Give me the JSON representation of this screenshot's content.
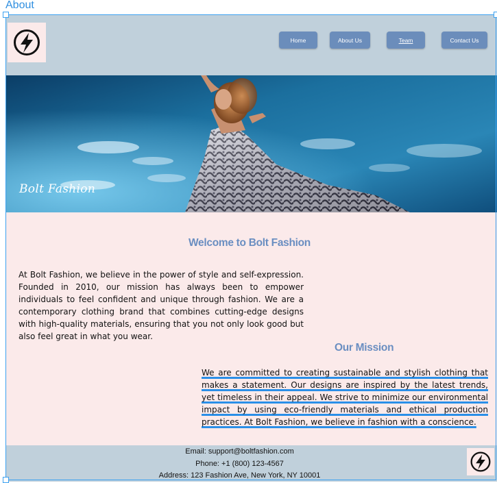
{
  "frame": {
    "label": "About"
  },
  "header": {
    "logo_icon": "lightning-bolt-icon",
    "nav": [
      {
        "label": "Home",
        "current": false
      },
      {
        "label": "About Us",
        "current": false
      },
      {
        "label": "Team",
        "current": true
      },
      {
        "label": "Contact Us",
        "current": false
      }
    ]
  },
  "hero": {
    "brand": "Bolt Fashion"
  },
  "welcome": {
    "title": "Welcome to Bolt Fashion",
    "body": "At Bolt Fashion, we believe in the power of style and self-expression. Founded in 2010, our mission has always been to empower individuals to feel confident and unique through fashion. We are a contemporary clothing brand that combines cutting-edge designs with high-quality materials, ensuring that you not only look good but also feel great in what you wear."
  },
  "mission": {
    "title": "Our Mission",
    "body": "We are committed to creating sustainable and stylish clothing that makes a statement. Our designs are inspired by the latest trends, yet timeless in their appeal. We strive to minimize our environmental impact by using eco-friendly materials and ethical production practices. At Bolt Fashion, we believe in fashion with a conscience."
  },
  "footer": {
    "email": "Email: support@boltfashion.com",
    "phone": "Phone: +1 (800) 123-4567",
    "address": "Address: 123 Fashion Ave, New York, NY 10001"
  },
  "colors": {
    "header_bg": "#c0d0db",
    "page_bg": "#fbeaea",
    "nav_button": "#6b8dbb",
    "heading": "#6a8ec1",
    "selection": "#3aa0f0"
  }
}
